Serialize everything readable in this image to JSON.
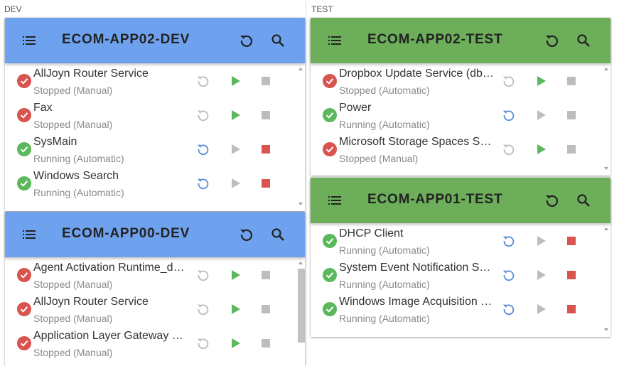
{
  "columns": {
    "dev_label": "DEV",
    "test_label": "TEST"
  },
  "colors": {
    "dev_header": "#6fa2ee",
    "test_header": "#6cae5a",
    "ok": "#5cb85c",
    "error": "#d9534f",
    "start_active": "#5cb85c",
    "stop_active": "#d9534f",
    "restart_active": "#5b8fd8",
    "disabled": "#bdbdbd"
  },
  "icons": {
    "menu": "list-icon",
    "refresh": "refresh-icon",
    "search": "search-icon",
    "status_ok": "check-circle-icon",
    "status_bad": "check-circle-icon",
    "restart": "restart-icon",
    "start": "play-icon",
    "stop": "stop-icon"
  },
  "servers": [
    {
      "title": "ECOM-APP02-DEV",
      "services": [
        {
          "name": "AllJoyn Router Service",
          "state": "Stopped (Manual)",
          "running": false
        },
        {
          "name": "Fax",
          "state": "Stopped (Manual)",
          "running": false
        },
        {
          "name": "SysMain",
          "state": "Running (Automatic)",
          "running": true
        },
        {
          "name": "Windows Search",
          "state": "Running (Automatic)",
          "running": true
        }
      ]
    },
    {
      "title": "ECOM-APP00-DEV",
      "services": [
        {
          "name": "Agent Activation Runtime_d4…",
          "state": "Stopped (Manual)",
          "running": false
        },
        {
          "name": "AllJoyn Router Service",
          "state": "Stopped (Manual)",
          "running": false
        },
        {
          "name": "Application Layer Gateway S…",
          "state": "Stopped (Manual)",
          "running": false
        }
      ]
    },
    {
      "title": "ECOM-APP02-TEST",
      "services": [
        {
          "name": "Dropbox Update Service (db…",
          "state": "Stopped (Automatic)",
          "running": false
        },
        {
          "name": "Power",
          "state": "Running (Automatic)",
          "running": true
        },
        {
          "name": "Microsoft Storage Spaces S…",
          "state": "Stopped (Manual)",
          "running": false
        }
      ]
    },
    {
      "title": "ECOM-APP01-TEST",
      "services": [
        {
          "name": "DHCP Client",
          "state": "Running (Automatic)",
          "running": true
        },
        {
          "name": "System Event Notification Se…",
          "state": "Running (Automatic)",
          "running": true
        },
        {
          "name": "Windows Image Acquisition …",
          "state": "Running (Automatic)",
          "running": true
        }
      ]
    }
  ]
}
